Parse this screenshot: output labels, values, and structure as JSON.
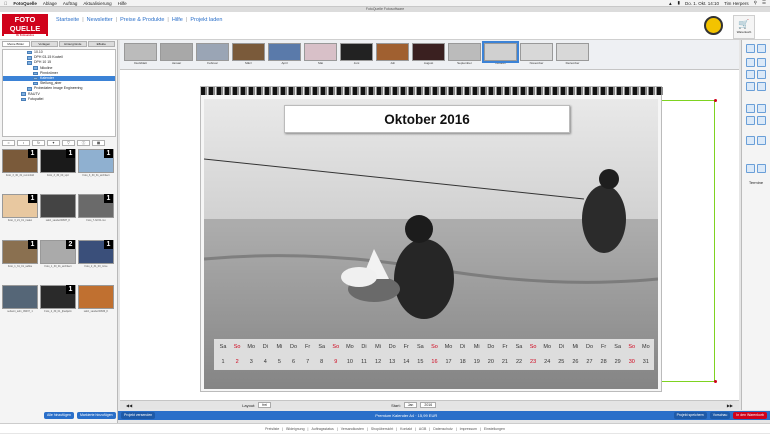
{
  "menubar": {
    "items": [
      "FotoQuelle",
      "Ablage",
      "Auftrag",
      "Aktualisierung",
      "Hilfe"
    ],
    "clock": "Do. 1. Okt. 14:10",
    "user": "Tim Herpers"
  },
  "window_title": "FotoQuelle Fotosoftware",
  "logo": {
    "line1": "FOTO",
    "line2": "QUELLE",
    "tagline": "Ihr Fotoservice"
  },
  "nav": {
    "items": [
      "Startseite",
      "Newsletter",
      "Preise & Produkte",
      "Hilfe",
      "Projekt laden"
    ],
    "separator": "|"
  },
  "cart": {
    "label": "Warenkorb"
  },
  "left_panel": {
    "tabs": [
      "Meine Bilder",
      "Vorlagen",
      "Hintergründe",
      "Effekte"
    ],
    "tree": [
      {
        "label": "10.10",
        "indent": 4,
        "selected": false
      },
      {
        "label": "DPH 03-15 Kocteil",
        "indent": 4,
        "selected": false
      },
      {
        "label": "DPH 10 15",
        "indent": 4,
        "selected": false
      },
      {
        "label": "Nikoline",
        "indent": 5,
        "selected": false
      },
      {
        "label": "Pinnkrümer",
        "indent": 5,
        "selected": false
      },
      {
        "label": "Kalender",
        "indent": 5,
        "selected": true
      },
      {
        "label": "Stellung_aber",
        "indent": 5,
        "selected": false
      },
      {
        "label": "Probedaten Image Engineering",
        "indent": 4,
        "selected": false
      },
      {
        "label": "RAUTV",
        "indent": 3,
        "selected": false
      },
      {
        "label": "Fotopaltei",
        "indent": 3,
        "selected": false
      }
    ],
    "thumbs": [
      {
        "caption": "Foto_3_30_31_remmfold",
        "badge": "1",
        "color": "#7a5a3a"
      },
      {
        "caption": "Foto_3_30_00_sprt",
        "badge": "1",
        "color": "#1a1a1a"
      },
      {
        "caption": "Foto_3_30_31_architect",
        "badge": "1",
        "color": "#8fb0d0"
      },
      {
        "caption": "Foto_3_21_01_malen",
        "badge": "1",
        "color": "#e8c8a0"
      },
      {
        "caption": "sabri_sander00837_K",
        "badge": "",
        "color": "#444444"
      },
      {
        "caption": "Foto_7-32-51-mo",
        "badge": "1",
        "color": "#6a6a6a"
      },
      {
        "caption": "Foto_1_31_01_sabbe",
        "badge": "1",
        "color": "#8a7050"
      },
      {
        "caption": "Foto_1_30_01_architect",
        "badge": "2",
        "color": "#aaaaaa"
      },
      {
        "caption": "Foto_2_31_00_mme",
        "badge": "1",
        "color": "#3a4f7a"
      },
      {
        "caption": "sebamt_telm_09037_1",
        "badge": "",
        "color": "#556677"
      },
      {
        "caption": "Foto_2_30_01_jbwdjarin",
        "badge": "1",
        "color": "#2a2a2a"
      },
      {
        "caption": "sabri_sander00836_K",
        "badge": "",
        "color": "#c07030"
      }
    ],
    "buttons": {
      "add_all": "Alle hinzufügen",
      "add_selected": "Markierte hinzufügen"
    }
  },
  "months": [
    {
      "label": "Deckblatt",
      "color": "#bbbbbb"
    },
    {
      "label": "Januar",
      "color": "#a8a8a8"
    },
    {
      "label": "Februar",
      "color": "#9aa5b5"
    },
    {
      "label": "März",
      "color": "#7a5a3a"
    },
    {
      "label": "April",
      "color": "#5a7aaa"
    },
    {
      "label": "Mai",
      "color": "#d8c0c8"
    },
    {
      "label": "Juni",
      "color": "#222222"
    },
    {
      "label": "Juli",
      "color": "#a06030"
    },
    {
      "label": "August",
      "color": "#3a2020"
    },
    {
      "label": "September",
      "color": "#bbbbbb"
    },
    {
      "label": "Oktober",
      "color": "#d0d0d0"
    },
    {
      "label": "November",
      "color": "#d8d8d8"
    },
    {
      "label": "Dezember",
      "color": "#d8d8d8"
    }
  ],
  "calendar": {
    "title": "Oktober 2016",
    "weekdays": [
      "Sa",
      "So",
      "Mo",
      "Di",
      "Mi",
      "Do",
      "Fr",
      "Sa",
      "So",
      "Mo",
      "Di",
      "Mi",
      "Do",
      "Fr",
      "Sa",
      "So",
      "Mo",
      "Di",
      "Mi",
      "Do",
      "Fr",
      "Sa",
      "So",
      "Mo",
      "Di",
      "Mi",
      "Do",
      "Fr",
      "Sa",
      "So",
      "Mo"
    ],
    "days": [
      "1",
      "2",
      "3",
      "4",
      "5",
      "6",
      "7",
      "8",
      "9",
      "10",
      "11",
      "12",
      "13",
      "14",
      "15",
      "16",
      "17",
      "18",
      "19",
      "20",
      "21",
      "22",
      "23",
      "24",
      "25",
      "26",
      "27",
      "28",
      "29",
      "30",
      "31"
    ],
    "weekend_color": "#d0021b"
  },
  "layout_bar": {
    "layout_label": "Layout:",
    "layout_value": "frei",
    "start_label": "Start:",
    "start_month": "Jan",
    "start_year": "2016"
  },
  "status_bar": {
    "left_button": "Projekt versenden",
    "product": "Premium Kalender A4 · 15,99 EUR",
    "btn_save": "Projekt speichern",
    "btn_preview": "Vorschau",
    "btn_cart": "In den Warenkorb"
  },
  "right_tools": {
    "termine": "Termine"
  },
  "footer": {
    "links": [
      "Preisliste",
      "Bildeignung",
      "Auftragsstatus",
      "Versandkosten",
      "Shopübersicht",
      "Kontakt",
      "AGB",
      "Datenschutz",
      "Impressum",
      "Einstellungen"
    ],
    "separator": "|"
  },
  "colors": {
    "accent": "#2a6fc9",
    "brand": "#d0021b",
    "selection": "#7ed321"
  }
}
